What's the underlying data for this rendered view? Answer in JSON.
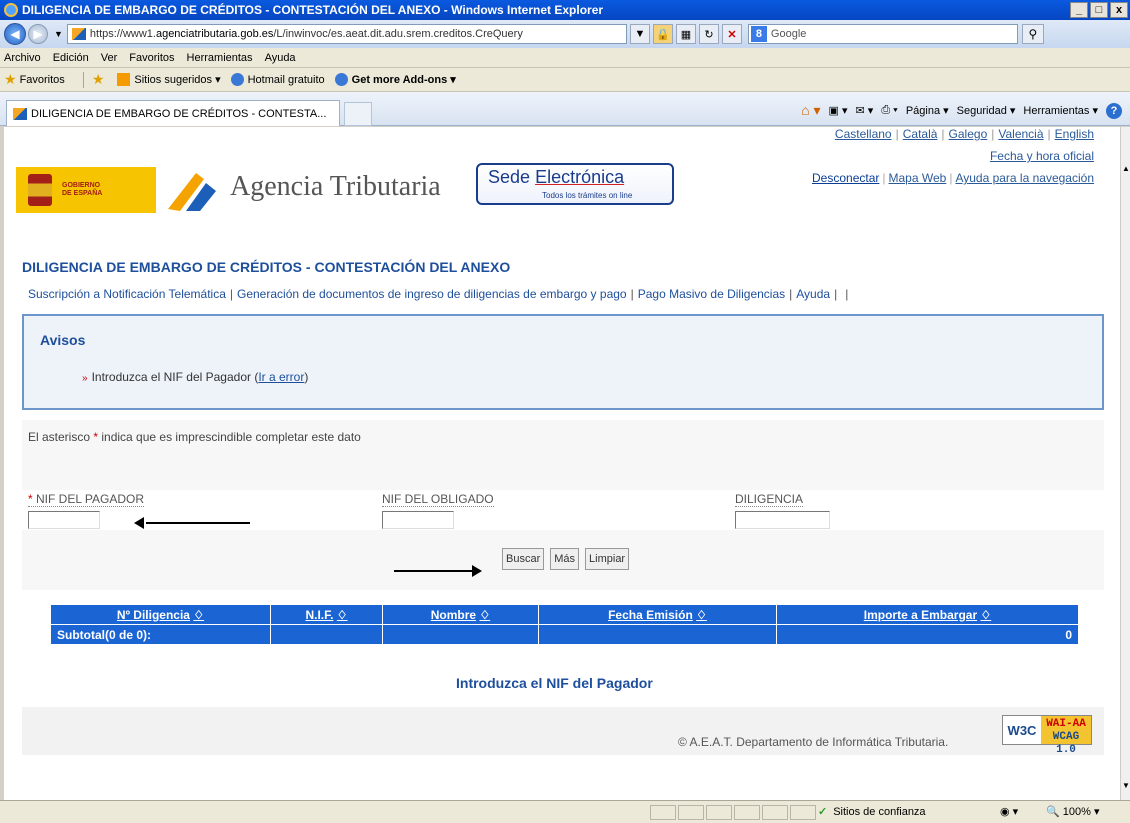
{
  "window": {
    "title": "DILIGENCIA DE EMBARGO DE CRÉDITOS - CONTESTACIÓN DEL ANEXO - Windows Internet Explorer",
    "controls": [
      "_",
      "□",
      "x"
    ]
  },
  "address_bar": {
    "url_prefix": "https://www1.",
    "url_domain": "agenciatributaria.gob.es",
    "url_path": "/L/inwinvoc/es.aeat.dit.adu.srem.creditos.CreQuery",
    "search_placeholder": "Google"
  },
  "menu": [
    "Archivo",
    "Edición",
    "Ver",
    "Favoritos",
    "Herramientas",
    "Ayuda"
  ],
  "favorites_bar": {
    "favorites": "Favoritos",
    "suggested": "Sitios sugeridos ▾",
    "hotmail": "Hotmail gratuito",
    "addons": "Get more Add-ons ▾"
  },
  "tab": {
    "label": "DILIGENCIA DE EMBARGO DE CRÉDITOS - CONTESTA..."
  },
  "command_bar": {
    "page": "Página ▾",
    "security": "Seguridad ▾",
    "tools": "Herramientas ▾"
  },
  "header": {
    "gobierno": "GOBIERNO\nDE ESPAÑA",
    "agency": "Agencia Tributaria",
    "sede_word1": "Sede",
    "sede_word2": "Electrónica",
    "sede_tagline": "Todos los trámites on line",
    "languages": [
      "Castellano",
      "Català",
      "Galego",
      "Valencià",
      "English"
    ],
    "official_time": "Fecha y hora oficial",
    "nav": [
      "Desconectar",
      "Mapa Web",
      "Ayuda para la navegación"
    ]
  },
  "page": {
    "title": "DILIGENCIA DE EMBARGO DE CRÉDITOS - CONTESTACIÓN DEL ANEXO",
    "sublinks": [
      "Suscripción a Notificación Telemática",
      "Generación de documentos de ingreso de diligencias de embargo y pago",
      "Pago Masivo de Diligencias",
      "Ayuda"
    ]
  },
  "avisos": {
    "heading": "Avisos",
    "message": "Introduzca el NIF del Pagador (",
    "link": "Ir a error",
    "close": ")"
  },
  "form": {
    "required_note_pre": "El asterisco ",
    "required_note_star": "*",
    "required_note_post": " indica que es imprescindible completar este dato",
    "fields": [
      {
        "label": "NIF DEL PAGADOR",
        "required": true,
        "value": ""
      },
      {
        "label": "NIF DEL OBLIGADO",
        "required": false,
        "value": ""
      },
      {
        "label": "DILIGENCIA",
        "required": false,
        "value": ""
      }
    ],
    "buttons": {
      "search": "Buscar",
      "more": "Más",
      "clear": "Limpiar"
    }
  },
  "results": {
    "columns": [
      "Nº Diligencia",
      "N.I.F.",
      "Nombre",
      "Fecha Emisión",
      "Importe a Embargar"
    ],
    "sort_glyph": "♢",
    "subtotal_label": "Subtotal(0 de 0):",
    "subtotal_value": "0"
  },
  "notice": "Introduzca el NIF del Pagador",
  "footer": {
    "copyright": "© A.E.A.T. Departamento de Informática Tributaria.",
    "badge_w3c": "W3C",
    "badge_line1": "WAI-AA",
    "badge_line2": "WCAG 1.0"
  },
  "status_bar": {
    "zone": "Sitios de confianza",
    "zoom": "100%"
  },
  "colors": {
    "brand_blue": "#1e4f9c",
    "table_blue": "#1a64d4",
    "required_red": "#cc0000"
  }
}
